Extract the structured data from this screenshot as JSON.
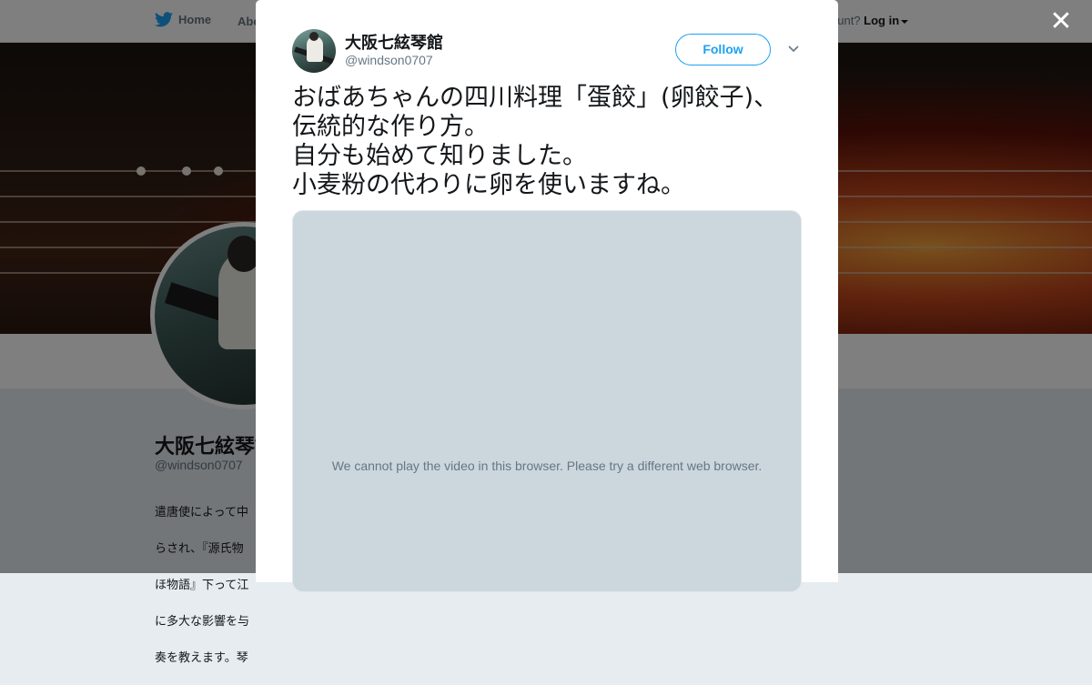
{
  "nav": {
    "home": "Home",
    "about": "Abo",
    "account_q": "ccount?",
    "login": "Log in"
  },
  "profile": {
    "name": "大阪七絃琴館",
    "handle": "@windson0707",
    "bio_lines": [
      "遣唐使によって中",
      "らされ、『源氏物",
      "ほ物語』下って江",
      "に多大な影響を与",
      "奏を教えます。琴"
    ]
  },
  "tweet": {
    "name": "大阪七絃琴館",
    "handle": "@windson0707",
    "follow_label": "Follow",
    "text_lines": [
      "おばあちゃんの四川料理「蛋餃」(卵餃子)、",
      "伝統的な作り方。",
      "自分も始めて知りました。",
      "小麦粉の代わりに卵を使いますね。"
    ],
    "video_message": "We cannot play the video in this browser. Please try a different web browser."
  },
  "colors": {
    "accent": "#1da1f2",
    "video_bg": "#ccd6dd",
    "overlay": "rgba(0,0,0,0.5)"
  },
  "icons": [
    "twitter-bird-icon",
    "close-icon",
    "chevron-down-icon"
  ]
}
